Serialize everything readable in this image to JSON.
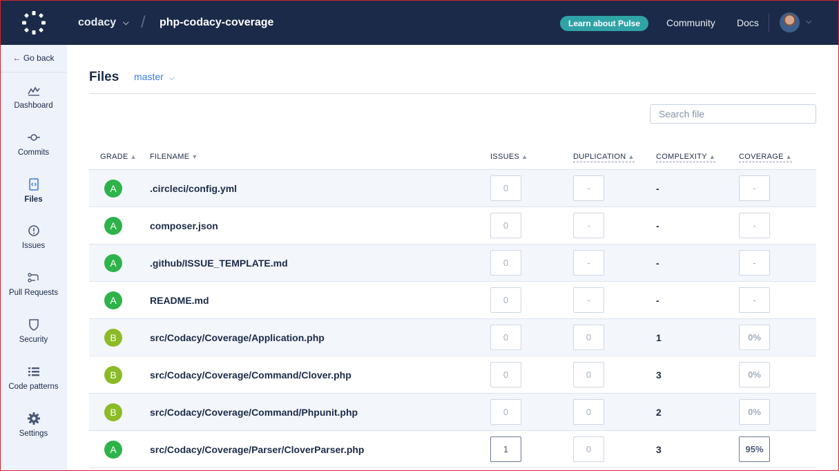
{
  "topbar": {
    "org": "codacy",
    "repo": "php-codacy-coverage",
    "pulse_label": "Learn about Pulse",
    "community": "Community",
    "docs": "Docs"
  },
  "sidebar": {
    "go_back": "← Go back",
    "items": [
      {
        "label": "Dashboard",
        "icon": "dashboard-icon"
      },
      {
        "label": "Commits",
        "icon": "commit-icon"
      },
      {
        "label": "Files",
        "icon": "file-code-icon",
        "active": true
      },
      {
        "label": "Issues",
        "icon": "alert-circle-icon"
      },
      {
        "label": "Pull Requests",
        "icon": "pull-request-icon"
      },
      {
        "label": "Security",
        "icon": "shield-icon"
      },
      {
        "label": "Code patterns",
        "icon": "list-icon"
      },
      {
        "label": "Settings",
        "icon": "gear-icon"
      }
    ]
  },
  "page": {
    "title": "Files",
    "branch": "master",
    "search_placeholder": "Search file"
  },
  "table": {
    "headers": {
      "grade": "GRADE",
      "filename": "FILENAME",
      "issues": "ISSUES",
      "duplication": "DUPLICATION",
      "complexity": "COMPLEXITY",
      "coverage": "COVERAGE"
    },
    "rows": [
      {
        "grade": "A",
        "filename": ".circleci/config.yml",
        "issues": "0",
        "duplication": "-",
        "complexity": "-",
        "coverage": "-"
      },
      {
        "grade": "A",
        "filename": "composer.json",
        "issues": "0",
        "duplication": "-",
        "complexity": "-",
        "coverage": "-"
      },
      {
        "grade": "A",
        "filename": ".github/ISSUE_TEMPLATE.md",
        "issues": "0",
        "duplication": "-",
        "complexity": "-",
        "coverage": "-"
      },
      {
        "grade": "A",
        "filename": "README.md",
        "issues": "0",
        "duplication": "-",
        "complexity": "-",
        "coverage": "-"
      },
      {
        "grade": "B",
        "filename": "src/Codacy/Coverage/Application.php",
        "issues": "0",
        "duplication": "0",
        "complexity": "1",
        "coverage": "0%"
      },
      {
        "grade": "B",
        "filename": "src/Codacy/Coverage/Command/Clover.php",
        "issues": "0",
        "duplication": "0",
        "complexity": "3",
        "coverage": "0%"
      },
      {
        "grade": "B",
        "filename": "src/Codacy/Coverage/Command/Phpunit.php",
        "issues": "0",
        "duplication": "0",
        "complexity": "2",
        "coverage": "0%"
      },
      {
        "grade": "A",
        "filename": "src/Codacy/Coverage/Parser/CloverParser.php",
        "issues": "1",
        "duplication": "0",
        "complexity": "3",
        "coverage": "95%"
      }
    ]
  },
  "colors": {
    "topbar": "#1b2a48",
    "sidebar": "#eef2fb",
    "accent": "#3a7be0",
    "pulse": "#2fa3a6",
    "grade_a": "#2db34a",
    "grade_b": "#8bbb27"
  }
}
